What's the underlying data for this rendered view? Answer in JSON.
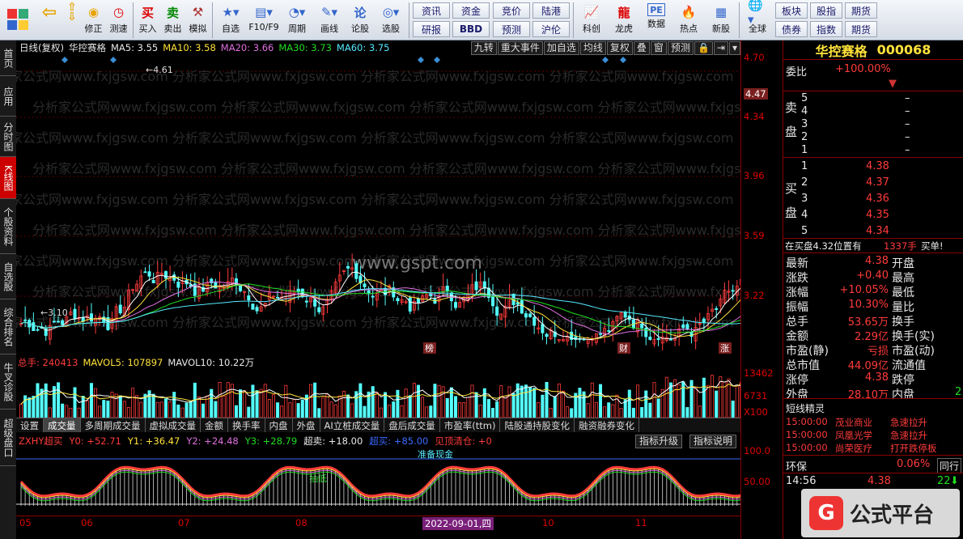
{
  "toolbar": {
    "buttons": [
      {
        "icon": "back-arrow-icon",
        "label": ""
      },
      {
        "icon": "home-icon",
        "label": "修正"
      },
      {
        "icon": "clock-icon",
        "label": "测速"
      },
      {
        "icon": "buy-icon",
        "label": "买入"
      },
      {
        "icon": "sell-icon",
        "label": "卖出"
      },
      {
        "icon": "hammer-icon",
        "label": "模拟"
      },
      {
        "icon": "star-icon",
        "label": "自选"
      },
      {
        "icon": "f10-icon",
        "label": "F10/F9"
      },
      {
        "icon": "period-icon",
        "label": "周期"
      },
      {
        "icon": "pen-icon",
        "label": "画线"
      },
      {
        "icon": "lun-icon",
        "label": "论股"
      },
      {
        "icon": "select-icon",
        "label": "选股"
      }
    ],
    "grid1": [
      "资讯",
      "资金",
      "研报",
      "BBD"
    ],
    "grid2": [
      "竞价",
      "陆港",
      "预测",
      "沪伦"
    ],
    "buttons2": [
      {
        "icon": "keyan-icon",
        "label": "科创"
      },
      {
        "icon": "dragon-icon",
        "label": "龙虎"
      },
      {
        "icon": "data-icon",
        "label": "数据"
      },
      {
        "icon": "hot-icon",
        "label": "热点"
      },
      {
        "icon": "new-icon",
        "label": "新股"
      },
      {
        "icon": "globe-icon",
        "label": "全球"
      }
    ],
    "grid3": [
      "板块",
      "股指",
      "期货",
      "债券",
      "指数",
      "期货"
    ]
  },
  "left_tabs": [
    "首页",
    "应用",
    "分时图",
    "K线图",
    "个股资料",
    "自选股",
    "综合排名",
    "牛叉诊股",
    "超级盘口"
  ],
  "active_left_tab": "K线图",
  "chart_header": {
    "period": "日线(复权)",
    "name": "华控赛格",
    "ma5": "MA5: 3.55",
    "ma10": "MA10: 3.58",
    "ma20": "MA20: 3.66",
    "ma30": "MA30: 3.73",
    "ma60": "MA60: 3.75"
  },
  "chart_tabs": [
    "九转",
    "重大事件",
    "加自选",
    "均线",
    "复权",
    "叠",
    "窗",
    "预测",
    "",
    "",
    ""
  ],
  "watermark_text": "www.gspt.com",
  "bg_watermark": "分析家公式网www.fxjgsw.com",
  "price_axis": [
    "4.70",
    "4.47",
    "4.34",
    "3.96",
    "3.59",
    "3.22"
  ],
  "price_labels": {
    "high": "4.61",
    "low": "3.10"
  },
  "event_marks": [
    "榜",
    "财",
    "涨"
  ],
  "volume_header": {
    "total": "总手: 240413",
    "mavol5": "MAVOL5: 107897",
    "mavol10": "MAVOL10: 10.22万"
  },
  "volume_axis": [
    "13462",
    "6731",
    "X100"
  ],
  "indicator_tabs": [
    "设置",
    "成交量",
    "多周期成交量",
    "虚拟成交量",
    "金额",
    "换手率",
    "内盘",
    "外盘",
    "AI立桩成交量",
    "盘后成交量",
    "市盈率(ttm)",
    "陆股通持股变化",
    "融资融券变化"
  ],
  "active_indicator_tab": "成交量",
  "osc_header": {
    "name": "ZXHY超买",
    "y0": "Y0: +52.71",
    "y1": "Y1: +36.47",
    "y2": "Y2: +24.48",
    "y3": "Y3: +28.79",
    "chaomai": "超卖: +18.00",
    "chaomai2": "超买: +85.00",
    "jianding": "见顶清仓: +0"
  },
  "osc_buttons": [
    "指标升级",
    "指标说明"
  ],
  "osc_axis": [
    "100.0",
    "50.00"
  ],
  "osc_notes": [
    "准备现金",
    "抽低"
  ],
  "x_axis": [
    "05",
    "06",
    "07",
    "08",
    "09",
    "10",
    "11"
  ],
  "date_flag": "2022-09-01,四",
  "stock": {
    "name": "华控赛格",
    "code": "000068",
    "weibi_label": "委比",
    "weibi_value": "+100.00%",
    "sell_label": "卖盘",
    "buy_label": "买盘",
    "sell": [
      {
        "n": "5",
        "p": "",
        "v": "–"
      },
      {
        "n": "4",
        "p": "",
        "v": "–"
      },
      {
        "n": "3",
        "p": "",
        "v": "–"
      },
      {
        "n": "2",
        "p": "",
        "v": "–"
      },
      {
        "n": "1",
        "p": "",
        "v": "–"
      }
    ],
    "buy": [
      {
        "n": "1",
        "p": "4.38"
      },
      {
        "n": "2",
        "p": "4.37"
      },
      {
        "n": "3",
        "p": "4.36"
      },
      {
        "n": "4",
        "p": "4.35"
      },
      {
        "n": "5",
        "p": "4.34"
      }
    ],
    "pending_text": "在买盘4.32位置有",
    "pending_vol": "1337手",
    "pending_tag": "买单!",
    "quotes": [
      {
        "l": "最新",
        "v": "4.38",
        "l2": "开盘",
        "v2": ""
      },
      {
        "l": "涨跌",
        "v": "+0.40",
        "l2": "最高",
        "v2": ""
      },
      {
        "l": "涨幅",
        "v": "+10.05%",
        "l2": "最低",
        "v2": ""
      },
      {
        "l": "振幅",
        "v": "10.30%",
        "l2": "量比",
        "v2": ""
      },
      {
        "l": "总手",
        "v": "53.65万",
        "l2": "换手",
        "v2": ""
      },
      {
        "l": "金额",
        "v": "2.29亿",
        "l2": "换手(实)",
        "v2": ""
      },
      {
        "l": "市盈(静)",
        "v": "亏损",
        "l2": "市盈(动)",
        "v2": ""
      },
      {
        "l": "总市值",
        "v": "44.09亿",
        "l2": "流通值",
        "v2": ""
      },
      {
        "l": "涨停",
        "v": "4.38",
        "l2": "跌停",
        "v2": ""
      },
      {
        "l": "外盘",
        "v": "28.10万",
        "l2": "内盘",
        "v2": "2"
      }
    ],
    "sprite_title": "短线精灵",
    "sprites": [
      {
        "t": "15:00:00",
        "name": "茂业商业",
        "ev": "急速拉升"
      },
      {
        "t": "15:00:00",
        "name": "凤凰光学",
        "ev": "急速拉升"
      },
      {
        "t": "15:00:00",
        "name": "尚荣医疗",
        "ev": "打开跌停板"
      }
    ],
    "sector_name": "环保",
    "sector_pct": "0.06%",
    "sector_tab": "同行",
    "tick_time": "14:56",
    "tick_price": "4.38",
    "tick_vol": "22"
  },
  "brand": "公式平台"
}
